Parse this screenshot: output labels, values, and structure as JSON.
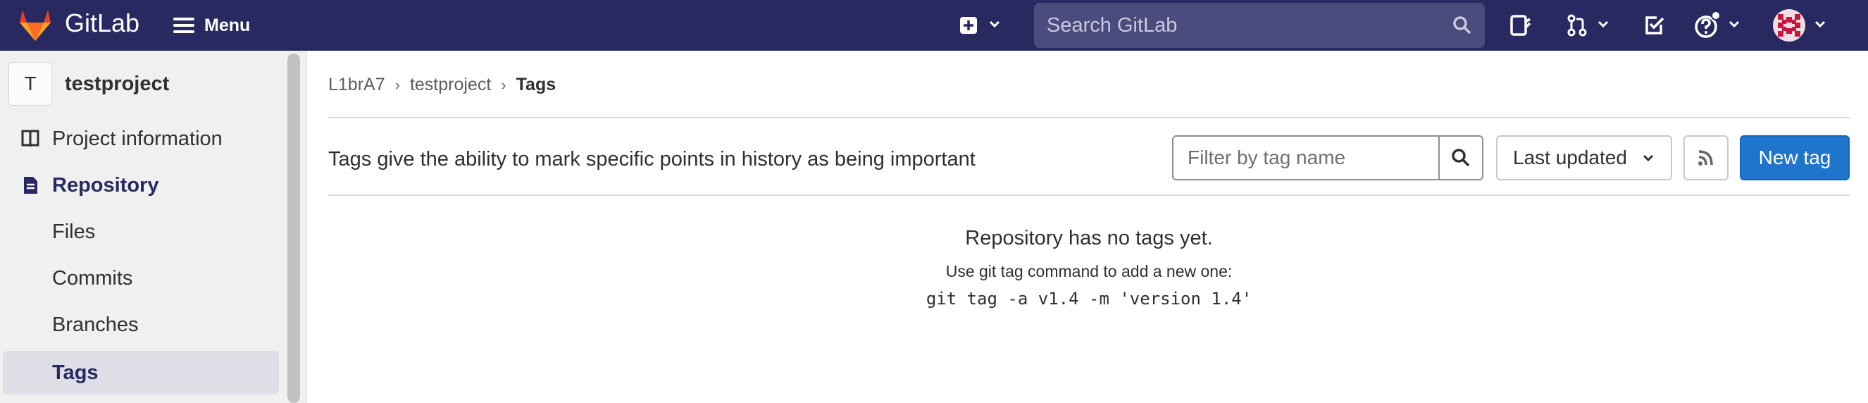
{
  "nav": {
    "brand": "GitLab",
    "menu_label": "Menu",
    "search_placeholder": "Search GitLab",
    "icons": [
      "plus-square-icon",
      "chevron-down-icon",
      "search-icon",
      "issues-icon",
      "merge-request-icon",
      "todo-icon",
      "help-icon",
      "user-avatar-icon"
    ]
  },
  "sidebar": {
    "project_avatar_letter": "T",
    "project_name": "testproject",
    "items": [
      {
        "label": "Project information",
        "icon": "project-icon"
      },
      {
        "label": "Repository",
        "icon": "repository-icon"
      },
      {
        "label": "Files"
      },
      {
        "label": "Commits"
      },
      {
        "label": "Branches"
      },
      {
        "label": "Tags"
      }
    ]
  },
  "breadcrumb": [
    "L1brA7",
    "testproject",
    "Tags"
  ],
  "main": {
    "description": "Tags give the ability to mark specific points in history as being important",
    "filter_placeholder": "Filter by tag name",
    "sort_label": "Last updated",
    "new_tag_label": "New tag",
    "empty_title": "Repository has no tags yet.",
    "empty_hint": "Use git tag command to add a new one:",
    "empty_command": "git tag -a v1.4 -m 'version 1.4'"
  },
  "colors": {
    "navbar": "#292961",
    "search_bg": "#4b4b7d",
    "primary_button": "#1f75cb",
    "sidebar_bg": "#f0f0f0"
  }
}
